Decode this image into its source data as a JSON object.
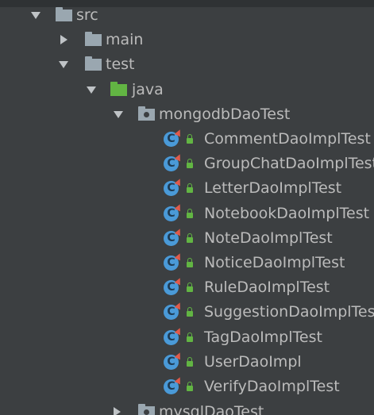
{
  "tree": {
    "src": "src",
    "main": "main",
    "test": "test",
    "java": "java",
    "mongodbDaoTest": "mongodbDaoTest",
    "classes": [
      "CommentDaoImplTest",
      "GroupChatDaoImplTest",
      "LetterDaoImplTest",
      "NotebookDaoImplTest",
      "NoteDaoImplTest",
      "NoticeDaoImplTest",
      "RuleDaoImplTest",
      "SuggestionDaoImplTest",
      "TagDaoImplTest",
      "UserDaoImpl",
      "VerifyDaoImplTest"
    ],
    "mysqlDaoTest": "mysqlDaoTest"
  },
  "icons": {
    "class_badge": "C",
    "class_icon": "java-test-class-icon",
    "access_icon": "package-private-lock-icon"
  },
  "colors": {
    "background": "#3c3f41",
    "text": "#bbbbbb",
    "folder": "#9aa7b0",
    "source_folder": "#62b543",
    "class_icon": "#4a9ad8"
  }
}
